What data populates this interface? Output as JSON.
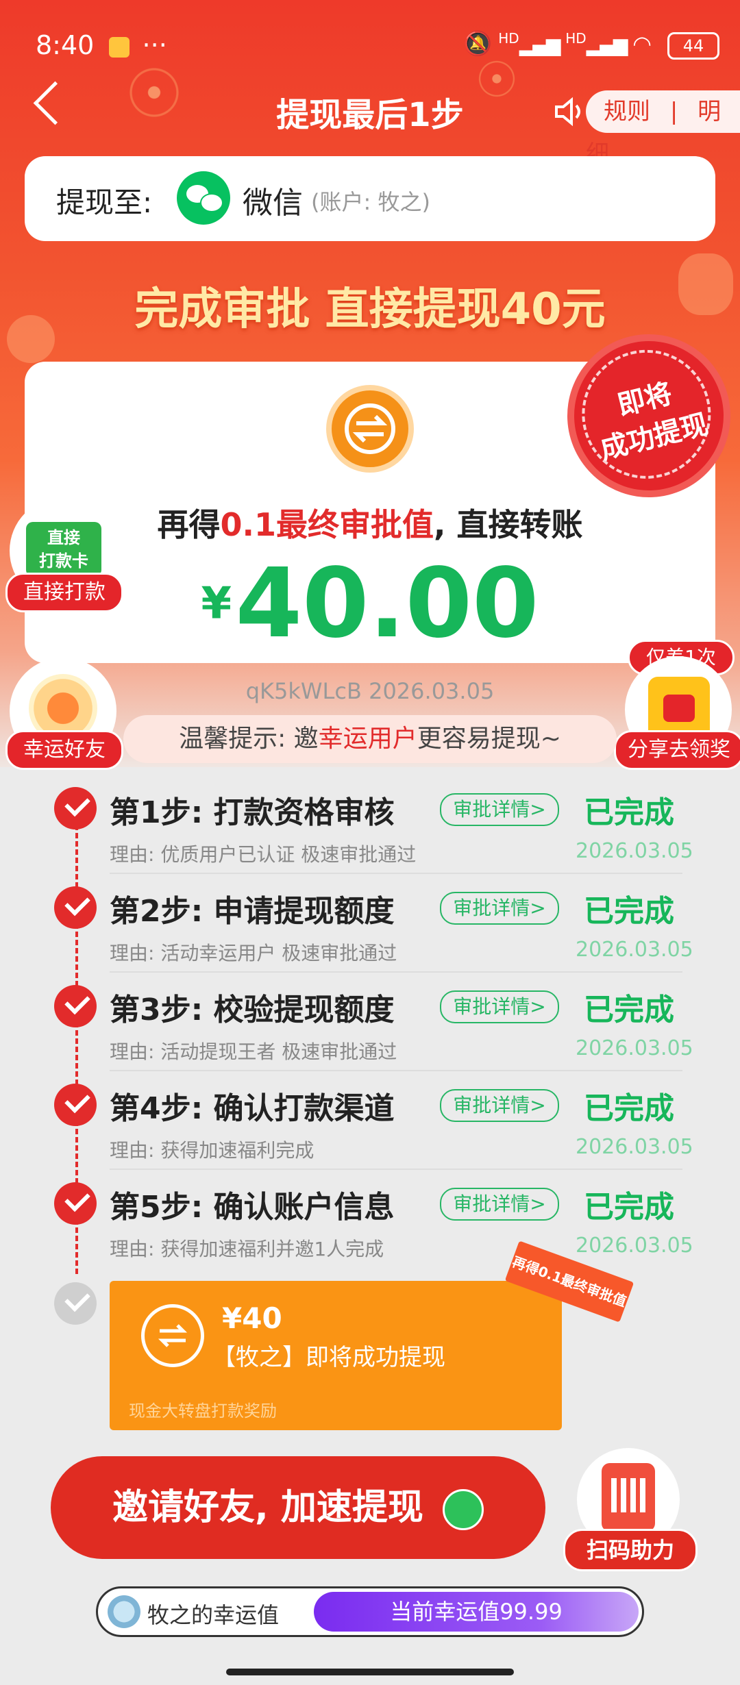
{
  "status_bar": {
    "time": "8:40",
    "dots": "···",
    "battery": "44",
    "signal1": "HD",
    "signal2": "HD"
  },
  "header": {
    "title": "提现最后1步",
    "rules": "规则",
    "separator": "|",
    "details": "明细"
  },
  "withdraw_to": {
    "label": "提现至:",
    "method": "微信",
    "account": "(账户: 牧之)"
  },
  "headline": "完成审批 直接提现40元",
  "main_card": {
    "line_prefix": "再得",
    "line_highlight": "0.1最终审批值",
    "line_suffix": ", 直接转账",
    "currency": "¥",
    "amount": "40.00",
    "stamp_line1": "即将",
    "stamp_line2": "成功提现"
  },
  "side_left_1": {
    "icon_line1": "直接",
    "icon_line2": "打款卡",
    "label": "直接打款"
  },
  "side_left_2": {
    "label": "幸运好友"
  },
  "side_right": {
    "top_label": "仅差1次",
    "label": "分享去领奖"
  },
  "order_code": "qK5kWLcB 2026.03.05",
  "tip": {
    "prefix": "温馨提示: 邀",
    "highlight": "幸运用户",
    "suffix": "更容易提现~"
  },
  "steps": [
    {
      "title": "第1步: 打款资格审核",
      "pill": "审批详情>",
      "status": "已完成",
      "reason": "理由: 优质用户已认证 极速审批通过",
      "date": "2026.03.05"
    },
    {
      "title": "第2步: 申请提现额度",
      "pill": "审批详情>",
      "status": "已完成",
      "reason": "理由: 活动幸运用户 极速审批通过",
      "date": "2026.03.05"
    },
    {
      "title": "第3步: 校验提现额度",
      "pill": "审批详情>",
      "status": "已完成",
      "reason": "理由: 活动提现王者 极速审批通过",
      "date": "2026.03.05"
    },
    {
      "title": "第4步: 确认打款渠道",
      "pill": "审批详情>",
      "status": "已完成",
      "reason": "理由: 获得加速福利完成",
      "date": "2026.03.05"
    },
    {
      "title": "第5步: 确认账户信息",
      "pill": "审批详情>",
      "status": "已完成",
      "reason": "理由: 获得加速福利并邀1人完成",
      "date": "2026.03.05"
    }
  ],
  "final_card": {
    "amount": "¥40",
    "text": "【牧之】即将成功提现",
    "sub": "现金大转盘打款奖励",
    "ribbon": "再得0.1最终审批值"
  },
  "invite_button": "邀请好友, 加速提现",
  "qr": {
    "label": "扫码助力"
  },
  "luck": {
    "name": "牧之的幸运值",
    "current": "当前幸运值99.99"
  },
  "colors": {
    "primary_red": "#e22b2b",
    "success_green": "#17b65a",
    "orange": "#fa9414",
    "purple": "#7a2cf0"
  }
}
